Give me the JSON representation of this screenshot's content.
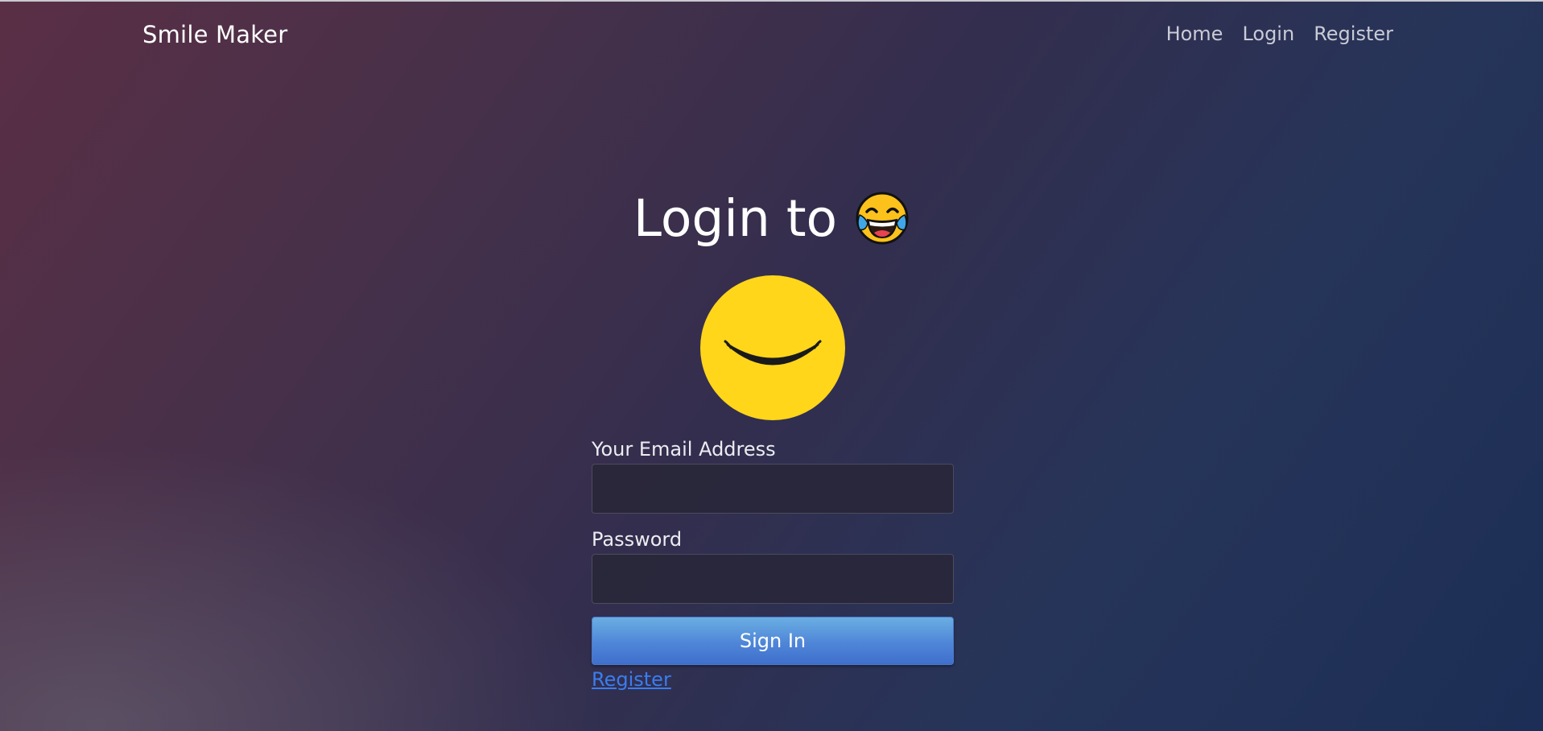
{
  "navbar": {
    "brand": "Smile Maker",
    "links": [
      "Home",
      "Login",
      "Register"
    ]
  },
  "hero": {
    "title": "Login to",
    "title_emoji": "face-with-tears-of-joy-icon"
  },
  "form": {
    "email_label": "Your Email Address",
    "email_value": "",
    "password_label": "Password",
    "password_value": "",
    "submit_label": "Sign In",
    "register_link": "Register"
  },
  "colors": {
    "accent_button": "#4f86d8",
    "link": "#3a7df0",
    "smiley_yellow": "#ffd61a"
  }
}
